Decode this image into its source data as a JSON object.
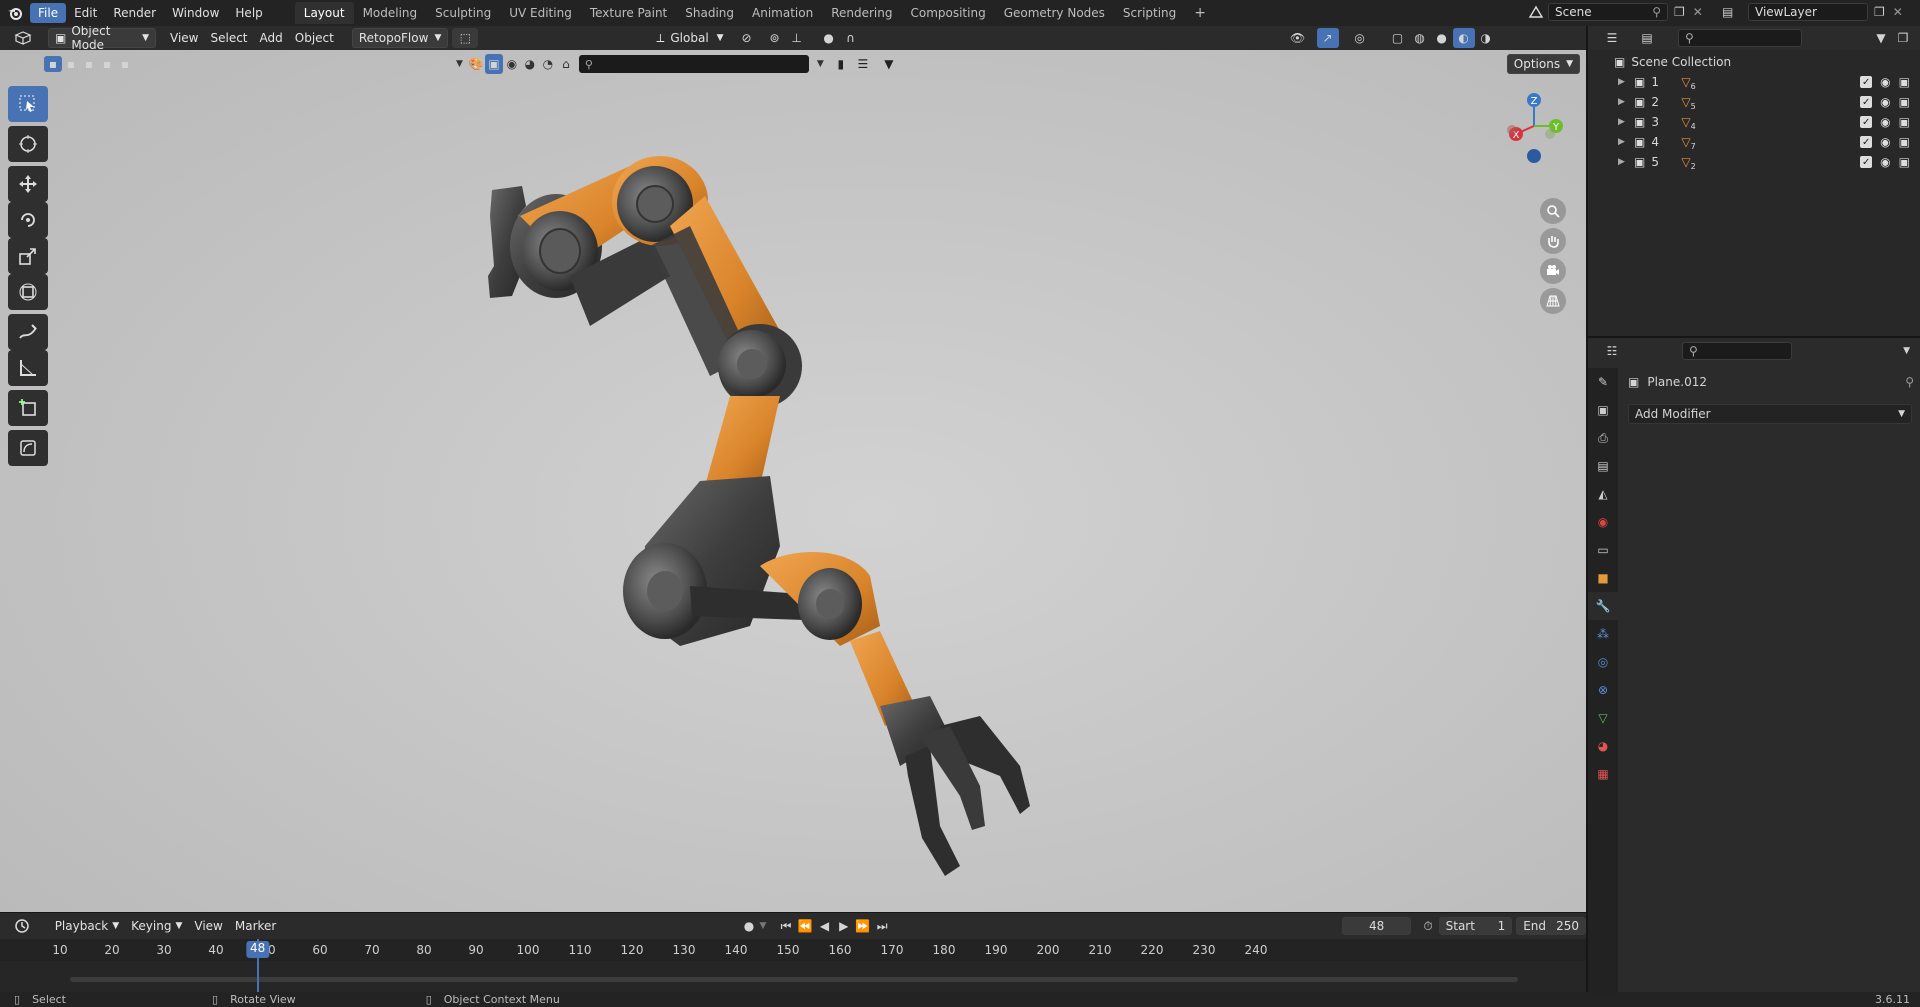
{
  "menu": {
    "items": [
      "File",
      "Edit",
      "Render",
      "Window",
      "Help"
    ],
    "active": "File"
  },
  "workspaces": {
    "tabs": [
      "Layout",
      "Modeling",
      "Sculpting",
      "UV Editing",
      "Texture Paint",
      "Shading",
      "Animation",
      "Rendering",
      "Compositing",
      "Geometry Nodes",
      "Scripting"
    ],
    "active": "Layout",
    "add_symbol": "+"
  },
  "scene": {
    "name": "Scene",
    "view_layer": "ViewLayer"
  },
  "viewport_header": {
    "mode": "Object Mode",
    "menus": [
      "View",
      "Select",
      "Add",
      "Object"
    ],
    "addon": "RetopoFlow",
    "orientation": "Global",
    "options_label": "Options"
  },
  "gizmo": {
    "x": "X",
    "y": "Y",
    "z": "Z"
  },
  "outliner": {
    "root": "Scene Collection",
    "rows": [
      {
        "label": "1",
        "sub": "6"
      },
      {
        "label": "2",
        "sub": "5"
      },
      {
        "label": "3",
        "sub": "4"
      },
      {
        "label": "4",
        "sub": "7"
      },
      {
        "label": "5",
        "sub": "2"
      }
    ]
  },
  "properties": {
    "object_name": "Plane.012",
    "add_modifier_label": "Add Modifier"
  },
  "timeline": {
    "menus": [
      "Playback",
      "Keying",
      "View",
      "Marker"
    ],
    "current_frame": "48",
    "start_label": "Start",
    "start_value": "1",
    "end_label": "End",
    "end_value": "250",
    "ruler_labels": [
      "10",
      "20",
      "30",
      "40",
      "50",
      "60",
      "70",
      "80",
      "90",
      "100",
      "110",
      "120",
      "130",
      "140",
      "150",
      "160",
      "170",
      "180",
      "190",
      "200",
      "210",
      "220",
      "230",
      "240"
    ],
    "ruler_values": [
      10,
      20,
      30,
      40,
      50,
      60,
      70,
      80,
      90,
      100,
      110,
      120,
      130,
      140,
      150,
      160,
      170,
      180,
      190,
      200,
      210,
      220,
      230,
      240
    ]
  },
  "statusbar": {
    "select": "Select",
    "rotate": "Rotate View",
    "context": "Object Context Menu",
    "version": "3.6.11"
  },
  "colors": {
    "accent": "#4772b3",
    "orange": "#d9842b",
    "viewport_bg": "#c8c8c8"
  }
}
